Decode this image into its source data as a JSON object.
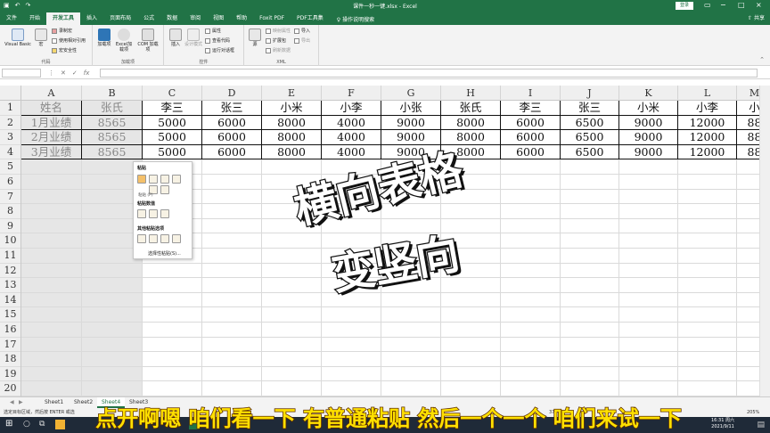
{
  "window": {
    "doc_title": "课件一秒一键.xlsx - Excel",
    "login_label": "登录",
    "qat_icons": [
      "save-icon",
      "undo-icon",
      "redo-icon"
    ]
  },
  "tabs": {
    "items": [
      "文件",
      "开始",
      "开发工具",
      "插入",
      "页面布局",
      "公式",
      "数据",
      "审阅",
      "视图",
      "帮助",
      "Foxit PDF",
      "PDF工具集"
    ],
    "active": "开发工具",
    "tell_me": "操作说明搜索",
    "share": "共享"
  },
  "ribbon": {
    "code": {
      "label": "代码",
      "visual_basic": "Visual Basic",
      "macros": "宏",
      "record": "录制宏",
      "relative": "使用相对引用",
      "security": "宏安全性"
    },
    "addins": {
      "label": "加载项",
      "addin": "加载项",
      "excel_addin": "Excel加载项",
      "com_addin": "COM 加载项"
    },
    "controls": {
      "label": "控件",
      "insert": "插入",
      "design": "设计模式",
      "properties": "属性",
      "view_code": "查看代码",
      "run_dialog": "运行对话框"
    },
    "xml": {
      "label": "XML",
      "source": "源",
      "map_props": "映射属性",
      "expansion": "扩展包",
      "refresh": "刷新数据",
      "import": "导入",
      "export": "导出"
    }
  },
  "grid": {
    "columns": [
      "A",
      "B",
      "C",
      "D",
      "E",
      "F",
      "G",
      "H",
      "I",
      "J",
      "K",
      "L",
      "M"
    ],
    "rows": [
      "1",
      "2",
      "3",
      "4",
      "5",
      "6",
      "7",
      "8",
      "9",
      "10",
      "11",
      "12",
      "13",
      "14",
      "15",
      "16",
      "17",
      "18",
      "19",
      "20"
    ],
    "data": [
      [
        "姓名",
        "张氏",
        "李三",
        "张三",
        "小米",
        "小李",
        "小张",
        "张氏",
        "李三",
        "张三",
        "小米",
        "小李",
        "小"
      ],
      [
        "1月业绩",
        "8565",
        "5000",
        "6000",
        "8000",
        "4000",
        "9000",
        "8000",
        "6000",
        "6500",
        "9000",
        "12000",
        "88"
      ],
      [
        "2月业绩",
        "8565",
        "5000",
        "6000",
        "8000",
        "4000",
        "9000",
        "8000",
        "6000",
        "6500",
        "9000",
        "12000",
        "88"
      ],
      [
        "3月业绩",
        "8565",
        "5000",
        "6000",
        "8000",
        "4000",
        "9000",
        "8000",
        "6000",
        "6500",
        "9000",
        "12000",
        "88"
      ]
    ]
  },
  "paste_menu": {
    "paste_label": "粘贴",
    "paste_values_label": "粘贴数值",
    "other_label": "其他粘贴选项",
    "tooltip": "粘贴 (P)",
    "special_link": "选择性粘贴(S)..."
  },
  "sheets": [
    "Sheet1",
    "Sheet2",
    "Sheet4",
    "Sheet3"
  ],
  "active_sheet": "Sheet4",
  "status_text": "选定目标区域，然后按 ENTER 或选",
  "status_right": "3743",
  "zoom": "205%",
  "taskbar": {
    "time": "16:31 周六",
    "date": "2021/9/11"
  },
  "overlay": {
    "line1": "横向表格",
    "line2": "变竖向"
  },
  "subtitle": "点开啊嗯 咱们看一下 有普通粘贴 然后一个一个 咱们来试一下",
  "colors": {
    "excel_green": "#217346",
    "subtitle_yellow": "#ffe000"
  }
}
